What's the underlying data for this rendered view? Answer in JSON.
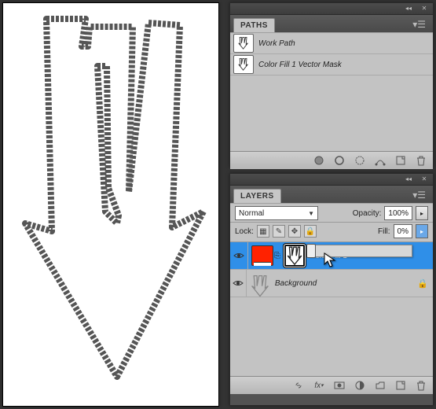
{
  "paths_panel": {
    "title": "PATHS",
    "items": [
      {
        "label": "Work Path"
      },
      {
        "label": "Color Fill 1 Vector Mask"
      }
    ],
    "footer_icons": [
      "fill-path",
      "stroke-path",
      "selection",
      "make-path",
      "new-path",
      "trash"
    ]
  },
  "layers_panel": {
    "title": "LAYERS",
    "blend_mode": "Normal",
    "opacity_label": "Opacity:",
    "opacity_value": "100%",
    "lock_label": "Lock:",
    "fill_label": "Fill:",
    "fill_value": "0%",
    "layers": [
      {
        "name": "Color Fill 1",
        "selected": true,
        "kind": "fill",
        "masked": true,
        "locked": false
      },
      {
        "name": "Background",
        "selected": false,
        "kind": "raster",
        "masked": false,
        "locked": true
      }
    ],
    "footer_icons": [
      "link",
      "fx",
      "mask",
      "adjustment",
      "group",
      "new",
      "trash"
    ]
  }
}
